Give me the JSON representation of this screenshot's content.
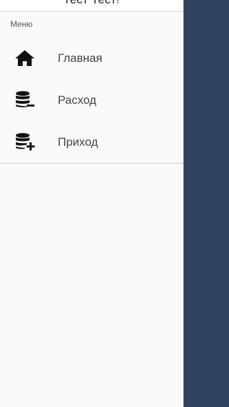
{
  "drawer": {
    "user_name": "Тест Тест!",
    "section_label": "Меню",
    "items": [
      {
        "label": "Главная",
        "icon": "home-icon"
      },
      {
        "label": "Расход",
        "icon": "database-minus-icon"
      },
      {
        "label": "Приход",
        "icon": "database-plus-icon"
      }
    ]
  },
  "colors": {
    "backdrop": "#2f4461",
    "drawer_background": "#fbfafb",
    "icon": "#111111"
  }
}
